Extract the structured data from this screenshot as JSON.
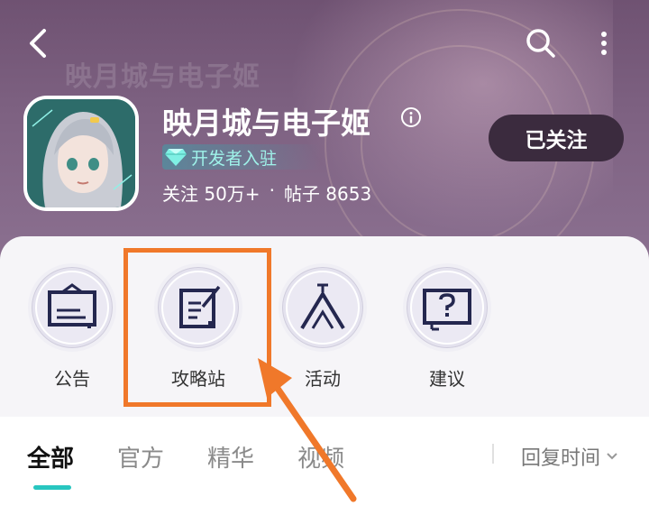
{
  "header": {
    "watermark": "映月城与电子姬",
    "forum_title": "映月城与电子姬",
    "developer_badge": "开发者入驻",
    "stats": {
      "follow_label": "关注",
      "follow_count": "50万+",
      "separator": "·",
      "post_label": "帖子",
      "post_count": "8653"
    },
    "follow_button": "已关注"
  },
  "quick_entries": [
    {
      "label": "公告",
      "icon": "announcement-board-icon"
    },
    {
      "label": "攻略站",
      "icon": "guide-notebook-icon"
    },
    {
      "label": "活动",
      "icon": "tent-activity-icon"
    },
    {
      "label": "建议",
      "icon": "question-board-icon"
    }
  ],
  "tabs": [
    {
      "label": "全部",
      "active": true
    },
    {
      "label": "官方",
      "active": false
    },
    {
      "label": "精华",
      "active": false
    },
    {
      "label": "视频",
      "active": false
    }
  ],
  "sort": {
    "label": "回复时间"
  },
  "colors": {
    "accent_teal": "#28c6c0",
    "highlight_orange": "#f0782a",
    "follow_button_bg": "#3b2b3e",
    "icon_navy": "#24274f"
  }
}
